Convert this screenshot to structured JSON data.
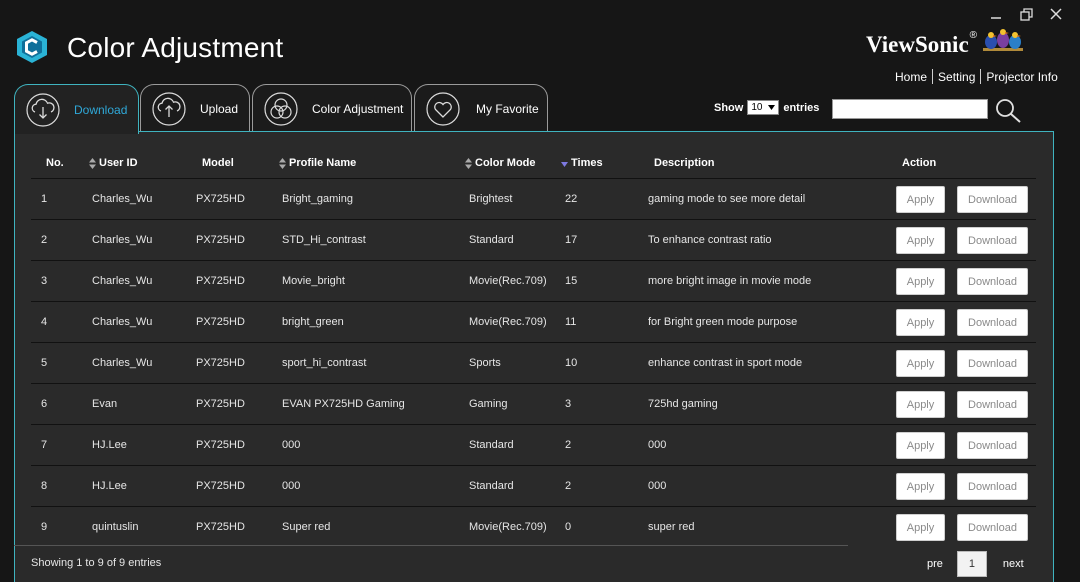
{
  "app": {
    "title": "Color Adjustment",
    "brand": "ViewSonic",
    "brand_mark": "®"
  },
  "window_controls": [
    "minimize",
    "restore",
    "close"
  ],
  "top_links": [
    "Home",
    "Setting",
    "Projector Info"
  ],
  "tabs": [
    {
      "label": "Download",
      "icon": "cloud-download-icon",
      "active": true
    },
    {
      "label": "Upload",
      "icon": "cloud-upload-icon",
      "active": false
    },
    {
      "label": "Color Adjustment",
      "icon": "color-circles-icon",
      "active": false
    },
    {
      "label": "My Favorite",
      "icon": "heart-icon",
      "active": false
    }
  ],
  "entries": {
    "show_label": "Show",
    "value": "10",
    "suffix": "entries"
  },
  "search": {
    "value": "",
    "placeholder": ""
  },
  "table": {
    "headers": {
      "no": "No.",
      "user_id": "User ID",
      "model": "Model",
      "profile_name": "Profile Name",
      "color_mode": "Color Mode",
      "times": "Times",
      "description": "Description",
      "action": "Action"
    },
    "apply_label": "Apply",
    "download_label": "Download",
    "rows": [
      {
        "no": "1",
        "user_id": "Charles_Wu",
        "model": "PX725HD",
        "profile_name": "Bright_gaming",
        "color_mode": "Brightest",
        "times": "22",
        "description": "gaming mode to see more detail"
      },
      {
        "no": "2",
        "user_id": "Charles_Wu",
        "model": "PX725HD",
        "profile_name": "STD_Hi_contrast",
        "color_mode": "Standard",
        "times": "17",
        "description": "To enhance contrast ratio"
      },
      {
        "no": "3",
        "user_id": "Charles_Wu",
        "model": "PX725HD",
        "profile_name": "Movie_bright",
        "color_mode": "Movie(Rec.709)",
        "times": "15",
        "description": "more bright image in movie mode"
      },
      {
        "no": "4",
        "user_id": "Charles_Wu",
        "model": "PX725HD",
        "profile_name": "bright_green",
        "color_mode": "Movie(Rec.709)",
        "times": "11",
        "description": "for Bright green mode purpose"
      },
      {
        "no": "5",
        "user_id": "Charles_Wu",
        "model": "PX725HD",
        "profile_name": "sport_hi_contrast",
        "color_mode": "Sports",
        "times": "10",
        "description": "enhance contrast in sport mode"
      },
      {
        "no": "6",
        "user_id": "Evan",
        "model": "PX725HD",
        "profile_name": "EVAN PX725HD Gaming",
        "color_mode": "Gaming",
        "times": "3",
        "description": "725hd gaming"
      },
      {
        "no": "7",
        "user_id": "HJ.Lee",
        "model": "PX725HD",
        "profile_name": "000",
        "color_mode": "Standard",
        "times": "2",
        "description": "000"
      },
      {
        "no": "8",
        "user_id": "HJ.Lee",
        "model": "PX725HD",
        "profile_name": "000",
        "color_mode": "Standard",
        "times": "2",
        "description": "000"
      },
      {
        "no": "9",
        "user_id": "quintuslin",
        "model": "PX725HD",
        "profile_name": "Super red",
        "color_mode": "Movie(Rec.709)",
        "times": "0",
        "description": "super red"
      }
    ]
  },
  "footer": {
    "info": "Showing 1 to 9 of 9 entries",
    "prev_label": "pre",
    "page": "1",
    "next_label": "next"
  },
  "colors": {
    "accent": "#3fb3bf",
    "active_tab_text": "#2fa8d8",
    "panel_bg": "#2a2a2a",
    "page_bg": "#161616"
  }
}
